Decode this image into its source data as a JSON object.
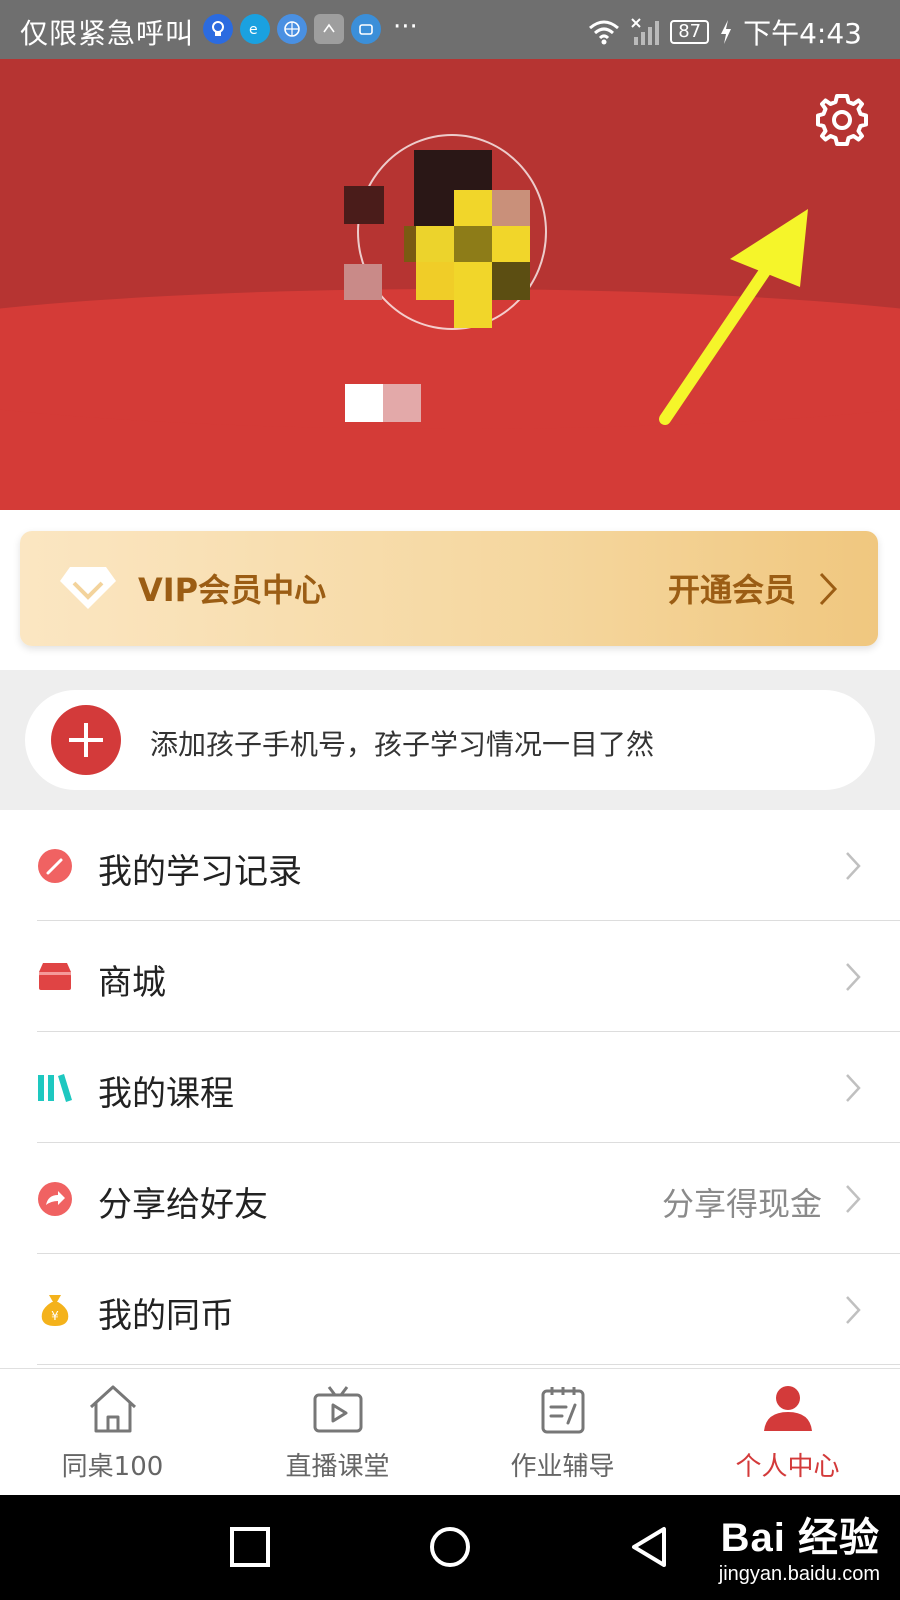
{
  "status_bar": {
    "emergency_text": "仅限紧急呼叫",
    "more": "···",
    "battery": "87",
    "time": "下午4:43",
    "app_icons": [
      {
        "name": "bulb-app-icon",
        "color": "#2b6be0"
      },
      {
        "name": "e-app-icon",
        "color": "#1aa1e0"
      },
      {
        "name": "globe-app-icon",
        "color": "#4a90e2"
      },
      {
        "name": "huawei-app-icon",
        "color": "#9e9e9e"
      },
      {
        "name": "wallet-app-icon",
        "color": "#3b8fd9"
      }
    ]
  },
  "vip": {
    "title": "VIP会员中心",
    "action": "开通会员"
  },
  "add_child": {
    "text": "添加孩子手机号，孩子学习情况一目了然"
  },
  "menu": {
    "items": [
      {
        "label": "我的学习记录",
        "sub": "",
        "icon": "pencil-icon",
        "color": "#f06262"
      },
      {
        "label": "商城",
        "sub": "",
        "icon": "store-icon",
        "color": "#e04444"
      },
      {
        "label": "我的课程",
        "sub": "",
        "icon": "books-icon",
        "color": "#1ec8c0"
      },
      {
        "label": "分享给好友",
        "sub": "分享得现金",
        "icon": "share-icon",
        "color": "#f06262"
      },
      {
        "label": "我的同币",
        "sub": "",
        "icon": "money-bag-icon",
        "color": "#f4b21b"
      }
    ]
  },
  "tabs": [
    {
      "label": "同桌100",
      "icon": "home-icon",
      "active": false
    },
    {
      "label": "直播课堂",
      "icon": "tv-icon",
      "active": false
    },
    {
      "label": "作业辅导",
      "icon": "notepad-icon",
      "active": false
    },
    {
      "label": "个人中心",
      "icon": "person-icon",
      "active": true
    }
  ],
  "watermark": {
    "brand": "Bai 经验",
    "url": "jingyan.baidu.com"
  },
  "colors": {
    "header_dark": "#b63432",
    "header_red": "#d43b37",
    "accent_red": "#d33a3a",
    "vip_gold": "#9b5d14",
    "arrow_yellow": "#f5f52a"
  }
}
